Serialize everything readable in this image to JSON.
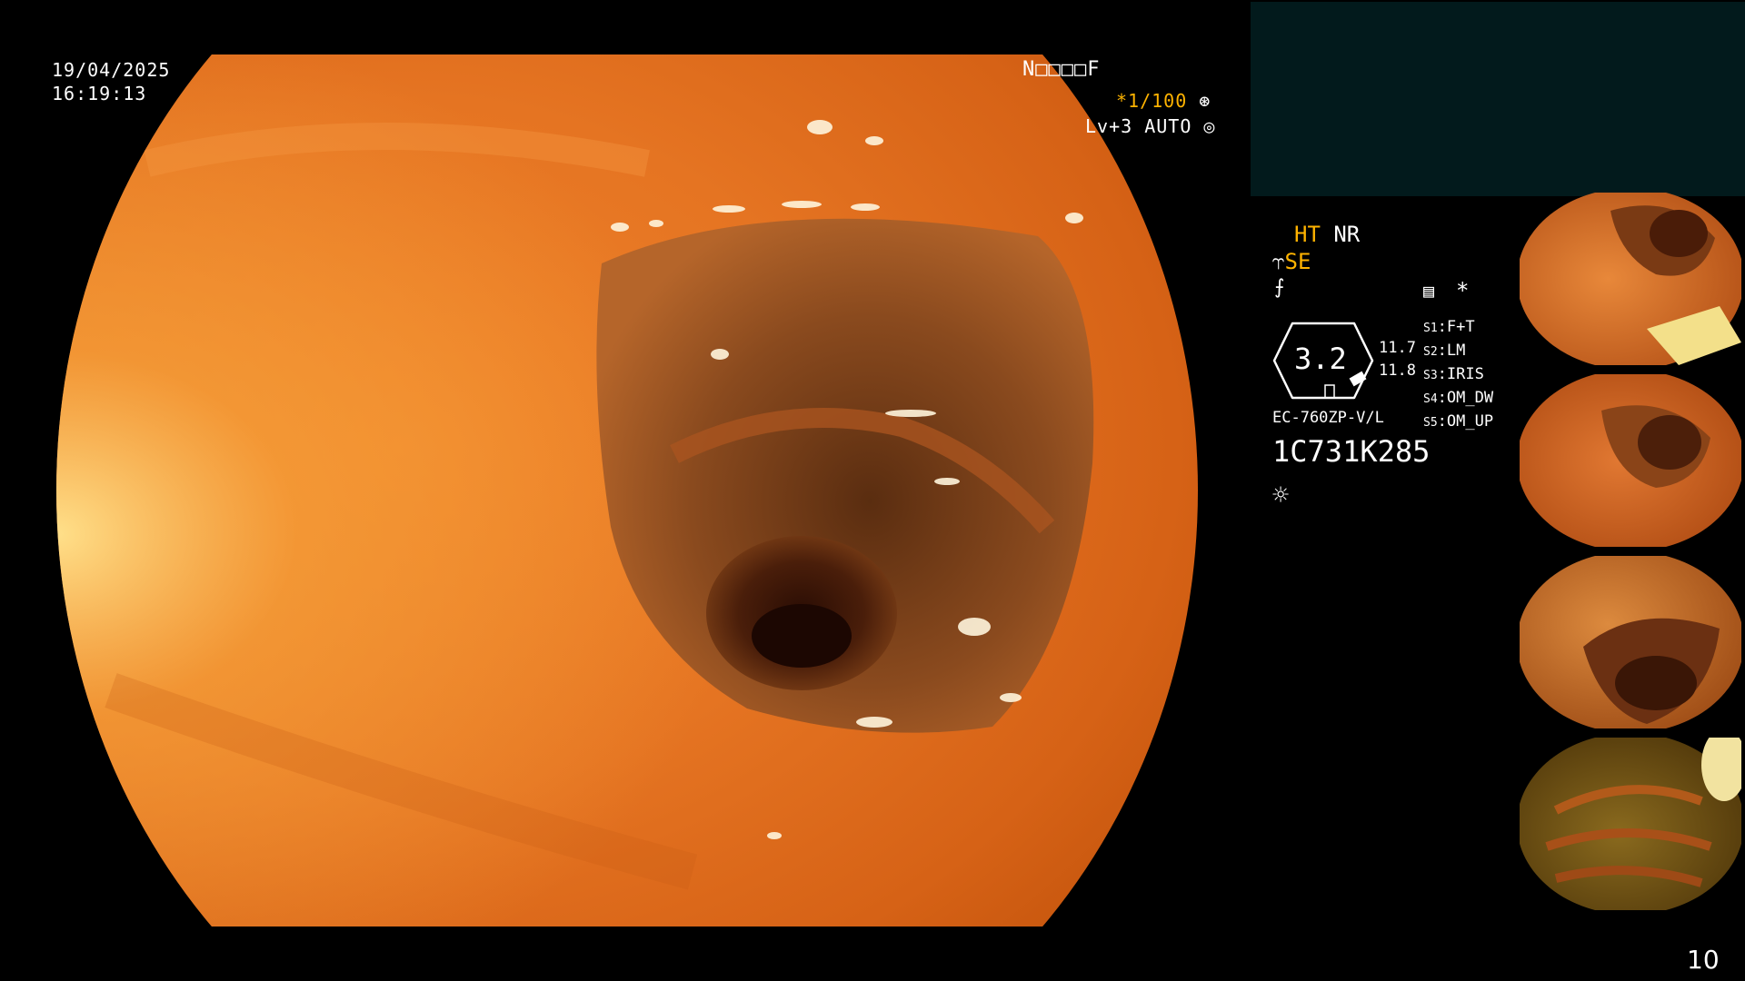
{
  "osd": {
    "date": "19/04/2025",
    "time": "16:19:13",
    "id_label": "N□□□□F",
    "shutter": "*1/100",
    "shutter_icon": "aperture-icon",
    "level": "Lv+3 AUTO",
    "level_icon": "target-icon"
  },
  "panel": {
    "ht": "HT",
    "nr": "NR",
    "se": "SE",
    "zoom_value": "3.2",
    "value_top": "11.7",
    "value_bottom": "11.8",
    "model": "EC-760ZP-V/L",
    "serial": "1C731K285",
    "asterisk": "*",
    "memo_icon": "memo-icon",
    "light_icon": "light-icon",
    "settings": [
      {
        "idx": "S1",
        "value": "F+T"
      },
      {
        "idx": "S2",
        "value": "LM"
      },
      {
        "idx": "S3",
        "value": "IRIS"
      },
      {
        "idx": "S4",
        "value": "OM_DW"
      },
      {
        "idx": "S5",
        "value": "OM_UP"
      }
    ]
  },
  "page_number": "10",
  "colors": {
    "accent": "#ffb300",
    "panel_bg": "#021a1c",
    "mucosa": "#e8741e"
  }
}
